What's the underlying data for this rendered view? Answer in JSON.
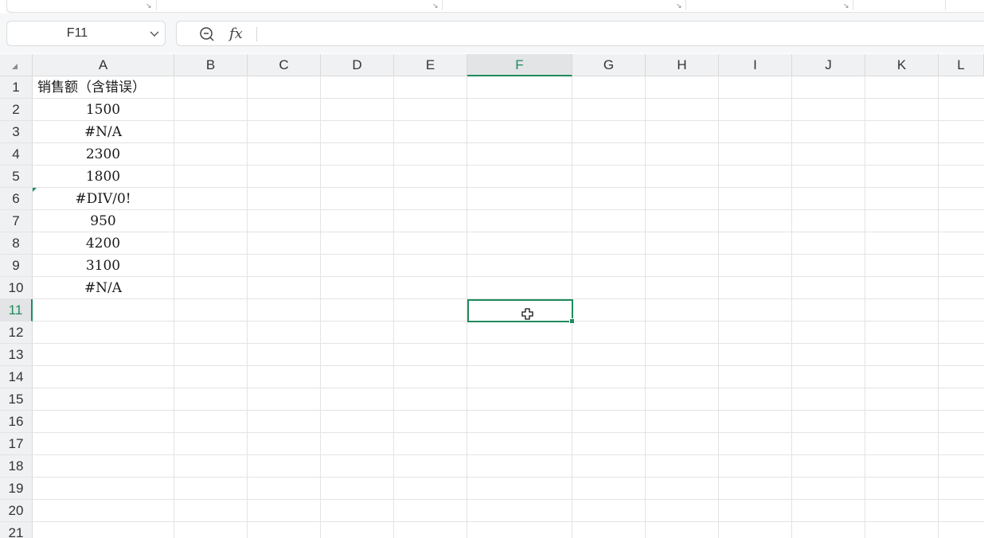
{
  "toolbar": {
    "name_box": "F11",
    "formula_content": "",
    "fx_label": "fx"
  },
  "columns": [
    "A",
    "B",
    "C",
    "D",
    "E",
    "F",
    "G",
    "H",
    "I",
    "J",
    "K",
    "L"
  ],
  "selected_column": "F",
  "rows": [
    "1",
    "2",
    "3",
    "4",
    "5",
    "6",
    "7",
    "8",
    "9",
    "10",
    "11",
    "12",
    "13",
    "14",
    "15",
    "16",
    "17",
    "18",
    "19",
    "20",
    "21"
  ],
  "selected_row": "11",
  "cells": {
    "A1": "销售额（含错误）",
    "A2": "1500",
    "A3": "#N/A",
    "A4": "2300",
    "A5": "1800",
    "A6": "#DIV/0!",
    "A7": "950",
    "A8": "4200",
    "A9": "3100",
    "A10": "#N/A"
  },
  "active_cell": "F11",
  "colors": {
    "accent": "#1f8a5b",
    "gridline": "#e3e3e3",
    "header_bg": "#f0f1f2"
  },
  "icons": {
    "zoom": "zoom-icon",
    "dropdown": "chevron-down-icon",
    "cursor": "cell-cursor-icon"
  }
}
